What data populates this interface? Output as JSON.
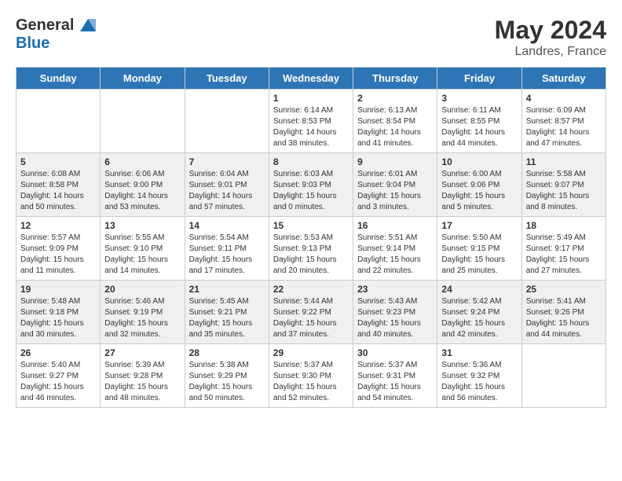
{
  "header": {
    "logo_general": "General",
    "logo_blue": "Blue",
    "month": "May 2024",
    "location": "Landres, France"
  },
  "days_of_week": [
    "Sunday",
    "Monday",
    "Tuesday",
    "Wednesday",
    "Thursday",
    "Friday",
    "Saturday"
  ],
  "weeks": [
    [
      {
        "day": "",
        "info": ""
      },
      {
        "day": "",
        "info": ""
      },
      {
        "day": "",
        "info": ""
      },
      {
        "day": "1",
        "info": "Sunrise: 6:14 AM\nSunset: 8:53 PM\nDaylight: 14 hours\nand 38 minutes."
      },
      {
        "day": "2",
        "info": "Sunrise: 6:13 AM\nSunset: 8:54 PM\nDaylight: 14 hours\nand 41 minutes."
      },
      {
        "day": "3",
        "info": "Sunrise: 6:11 AM\nSunset: 8:55 PM\nDaylight: 14 hours\nand 44 minutes."
      },
      {
        "day": "4",
        "info": "Sunrise: 6:09 AM\nSunset: 8:57 PM\nDaylight: 14 hours\nand 47 minutes."
      }
    ],
    [
      {
        "day": "5",
        "info": "Sunrise: 6:08 AM\nSunset: 8:58 PM\nDaylight: 14 hours\nand 50 minutes."
      },
      {
        "day": "6",
        "info": "Sunrise: 6:06 AM\nSunset: 9:00 PM\nDaylight: 14 hours\nand 53 minutes."
      },
      {
        "day": "7",
        "info": "Sunrise: 6:04 AM\nSunset: 9:01 PM\nDaylight: 14 hours\nand 57 minutes."
      },
      {
        "day": "8",
        "info": "Sunrise: 6:03 AM\nSunset: 9:03 PM\nDaylight: 15 hours\nand 0 minutes."
      },
      {
        "day": "9",
        "info": "Sunrise: 6:01 AM\nSunset: 9:04 PM\nDaylight: 15 hours\nand 3 minutes."
      },
      {
        "day": "10",
        "info": "Sunrise: 6:00 AM\nSunset: 9:06 PM\nDaylight: 15 hours\nand 5 minutes."
      },
      {
        "day": "11",
        "info": "Sunrise: 5:58 AM\nSunset: 9:07 PM\nDaylight: 15 hours\nand 8 minutes."
      }
    ],
    [
      {
        "day": "12",
        "info": "Sunrise: 5:57 AM\nSunset: 9:09 PM\nDaylight: 15 hours\nand 11 minutes."
      },
      {
        "day": "13",
        "info": "Sunrise: 5:55 AM\nSunset: 9:10 PM\nDaylight: 15 hours\nand 14 minutes."
      },
      {
        "day": "14",
        "info": "Sunrise: 5:54 AM\nSunset: 9:11 PM\nDaylight: 15 hours\nand 17 minutes."
      },
      {
        "day": "15",
        "info": "Sunrise: 5:53 AM\nSunset: 9:13 PM\nDaylight: 15 hours\nand 20 minutes."
      },
      {
        "day": "16",
        "info": "Sunrise: 5:51 AM\nSunset: 9:14 PM\nDaylight: 15 hours\nand 22 minutes."
      },
      {
        "day": "17",
        "info": "Sunrise: 5:50 AM\nSunset: 9:15 PM\nDaylight: 15 hours\nand 25 minutes."
      },
      {
        "day": "18",
        "info": "Sunrise: 5:49 AM\nSunset: 9:17 PM\nDaylight: 15 hours\nand 27 minutes."
      }
    ],
    [
      {
        "day": "19",
        "info": "Sunrise: 5:48 AM\nSunset: 9:18 PM\nDaylight: 15 hours\nand 30 minutes."
      },
      {
        "day": "20",
        "info": "Sunrise: 5:46 AM\nSunset: 9:19 PM\nDaylight: 15 hours\nand 32 minutes."
      },
      {
        "day": "21",
        "info": "Sunrise: 5:45 AM\nSunset: 9:21 PM\nDaylight: 15 hours\nand 35 minutes."
      },
      {
        "day": "22",
        "info": "Sunrise: 5:44 AM\nSunset: 9:22 PM\nDaylight: 15 hours\nand 37 minutes."
      },
      {
        "day": "23",
        "info": "Sunrise: 5:43 AM\nSunset: 9:23 PM\nDaylight: 15 hours\nand 40 minutes."
      },
      {
        "day": "24",
        "info": "Sunrise: 5:42 AM\nSunset: 9:24 PM\nDaylight: 15 hours\nand 42 minutes."
      },
      {
        "day": "25",
        "info": "Sunrise: 5:41 AM\nSunset: 9:26 PM\nDaylight: 15 hours\nand 44 minutes."
      }
    ],
    [
      {
        "day": "26",
        "info": "Sunrise: 5:40 AM\nSunset: 9:27 PM\nDaylight: 15 hours\nand 46 minutes."
      },
      {
        "day": "27",
        "info": "Sunrise: 5:39 AM\nSunset: 9:28 PM\nDaylight: 15 hours\nand 48 minutes."
      },
      {
        "day": "28",
        "info": "Sunrise: 5:38 AM\nSunset: 9:29 PM\nDaylight: 15 hours\nand 50 minutes."
      },
      {
        "day": "29",
        "info": "Sunrise: 5:37 AM\nSunset: 9:30 PM\nDaylight: 15 hours\nand 52 minutes."
      },
      {
        "day": "30",
        "info": "Sunrise: 5:37 AM\nSunset: 9:31 PM\nDaylight: 15 hours\nand 54 minutes."
      },
      {
        "day": "31",
        "info": "Sunrise: 5:36 AM\nSunset: 9:32 PM\nDaylight: 15 hours\nand 56 minutes."
      },
      {
        "day": "",
        "info": ""
      }
    ]
  ]
}
